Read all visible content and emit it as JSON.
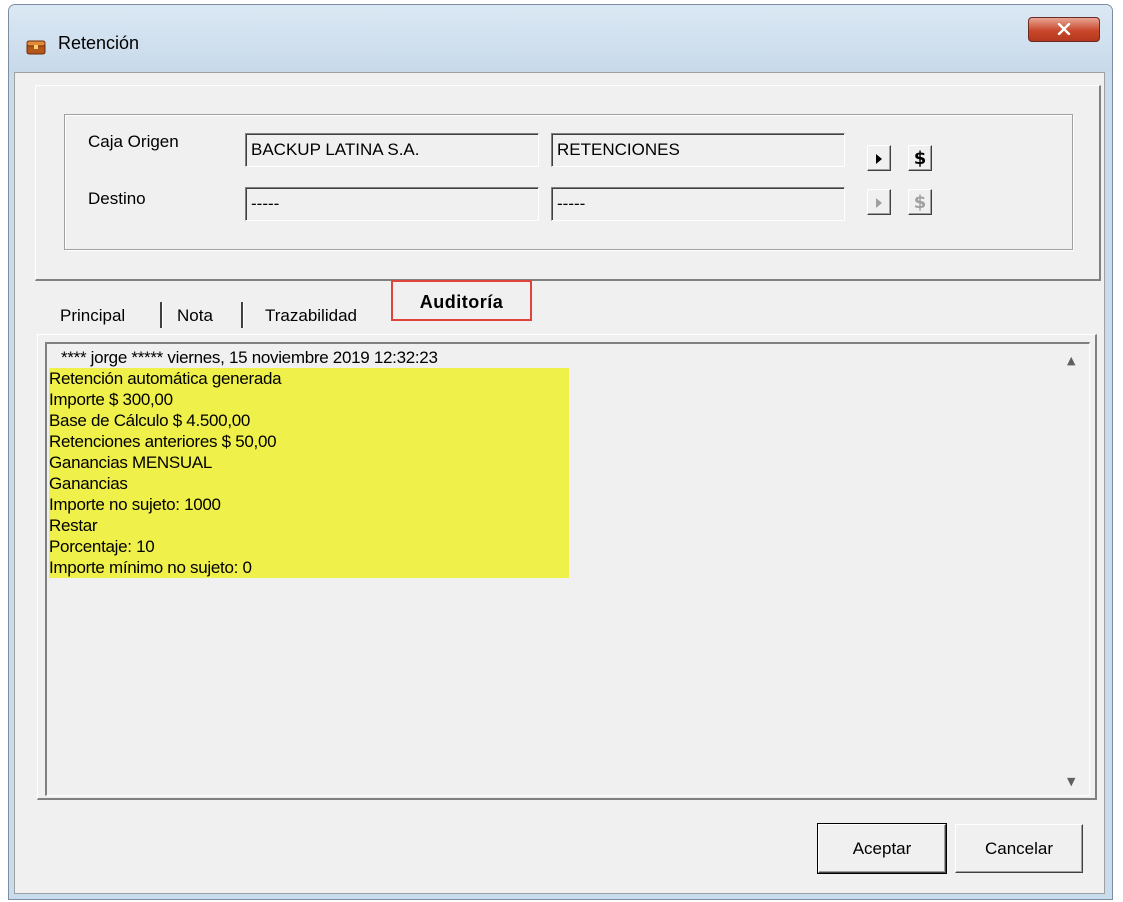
{
  "window": {
    "title": "Retención"
  },
  "origin": {
    "label": "Caja Origen",
    "company": "BACKUP LATINA S.A.",
    "account": "RETENCIONES",
    "arrow_icon": "triangle-right-icon",
    "money_label": "$"
  },
  "destination": {
    "label": "Destino",
    "company": "-----",
    "account": "-----",
    "arrow_icon": "triangle-right-icon",
    "money_label": "$"
  },
  "tabs": [
    {
      "label": "Principal"
    },
    {
      "label": "Nota"
    },
    {
      "label": "Trazabilidad"
    },
    {
      "label": "Auditoría",
      "active": true
    }
  ],
  "audit": {
    "header": " **** jorge *****   viernes, 15 noviembre 2019 12:32:23",
    "lines": [
      " Retención automática generada",
      "Importe $ 300,00",
      "Base de Cálculo $ 4.500,00",
      "Retenciones anteriores $ 50,00",
      "Ganancias MENSUAL",
      "Ganancias",
      "Importe no sujeto: 1000",
      "Restar",
      "Porcentaje: 10",
      "Importe mínimo no sujeto: 0"
    ],
    "highlight_color": "#f0f04a"
  },
  "buttons": {
    "accept": "Aceptar",
    "cancel": "Cancelar"
  },
  "colors": {
    "close_button": "#c9482c",
    "tab_highlight_border": "#e0433b"
  }
}
